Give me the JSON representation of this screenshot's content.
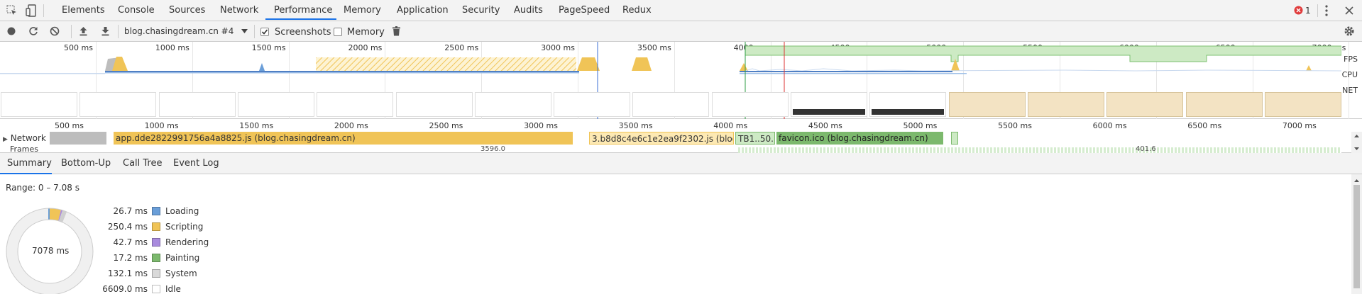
{
  "topbar": {
    "tabs": [
      "Elements",
      "Console",
      "Sources",
      "Network",
      "Performance",
      "Memory",
      "Application",
      "Security",
      "Audits",
      "PageSpeed",
      "Redux"
    ],
    "error_count": "1"
  },
  "toolbar": {
    "profile_select": "blog.chasingdream.cn #4",
    "screenshots_label": "Screenshots",
    "screenshots_checked": true,
    "memory_label": "Memory",
    "memory_checked": false
  },
  "overview": {
    "ruler": [
      "500 ms",
      "1000 ms",
      "1500 ms",
      "2000 ms",
      "2500 ms",
      "3000 ms",
      "3500 ms",
      "4000 ms",
      "4500 ms",
      "5000 ms",
      "5500 ms",
      "6000 ms",
      "6500 ms",
      "7000 ms"
    ],
    "side_labels": {
      "fps": "FPS",
      "cpu": "CPU",
      "net": "NET"
    }
  },
  "flamechart": {
    "ruler": [
      "500 ms",
      "1000 ms",
      "1500 ms",
      "2000 ms",
      "2500 ms",
      "3000 ms",
      "3500 ms",
      "4000 ms",
      "4500 ms",
      "5000 ms",
      "5500 ms",
      "6000 ms",
      "6500 ms",
      "7000 ms"
    ],
    "network_label": "Network",
    "frames_label": "Frames",
    "requests": [
      {
        "label": "app.dde2822991756a4a8825.js (blog.chasingdream.cn)"
      },
      {
        "label": "3.b8d8c4e6c1e2ea9f2302.js (blog...."
      },
      {
        "label": "TB1..50..."
      },
      {
        "label": "favicon.ico (blog.chasingdream.cn)"
      }
    ],
    "frames_partial": [
      "3596.0",
      "401.6"
    ]
  },
  "bottom_tabs": [
    "Summary",
    "Bottom-Up",
    "Call Tree",
    "Event Log"
  ],
  "summary": {
    "range": "Range: 0 – 7.08 s",
    "total": "7078 ms",
    "rows": [
      {
        "ms": "26.7 ms",
        "name": "Loading",
        "color": "#6a9ed8"
      },
      {
        "ms": "250.4 ms",
        "name": "Scripting",
        "color": "#f0c457"
      },
      {
        "ms": "42.7 ms",
        "name": "Rendering",
        "color": "#a98bde"
      },
      {
        "ms": "17.2 ms",
        "name": "Painting",
        "color": "#7cb96d"
      },
      {
        "ms": "132.1 ms",
        "name": "System",
        "color": "#d9d9d9"
      },
      {
        "ms": "6609.0 ms",
        "name": "Idle",
        "color": "#ffffff"
      }
    ]
  }
}
